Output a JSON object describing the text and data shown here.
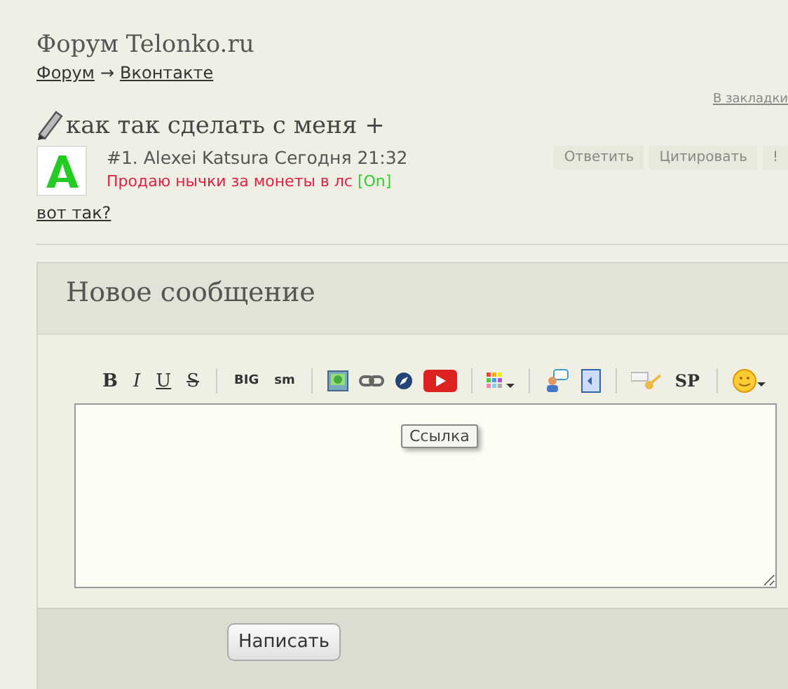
{
  "site_title": "Форум Telonko.ru",
  "breadcrumbs": {
    "links": [
      "Форум",
      "Вконтакте"
    ],
    "separator": "→"
  },
  "topic": {
    "title": "как так сделать с меня +",
    "bookmark": "В закладки"
  },
  "post": {
    "meta": "#1. Alexei Katsura Сегодня 21:32",
    "status": "Продаю нычки за монеты в лс",
    "online": "[On]",
    "actions": [
      "Ответить",
      "Цитировать",
      "!"
    ],
    "body": "вот так?"
  },
  "reply": {
    "title": "Новое сообщение",
    "toolbar": {
      "format": [
        {
          "label": "B",
          "kind": "bold"
        },
        {
          "label": "I",
          "kind": "italic"
        },
        {
          "label": "U",
          "kind": "underline"
        },
        {
          "label": "S",
          "kind": "strike"
        }
      ],
      "size": [
        "BIG",
        "sm"
      ],
      "spoiler": "SP"
    },
    "tooltip": "Ссылка",
    "submit": "Написать"
  }
}
